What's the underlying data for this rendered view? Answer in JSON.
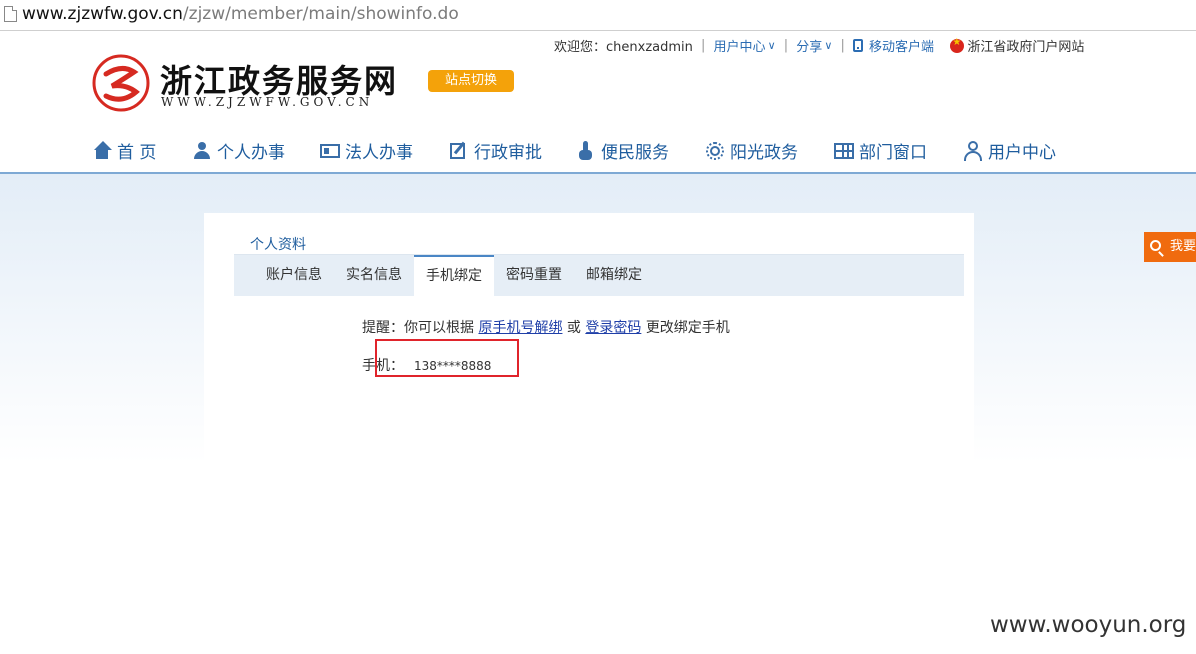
{
  "browser": {
    "url_host": "www.zjzwfw.gov.cn",
    "url_path": "/zjzw/member/main/showinfo.do"
  },
  "utility_bar": {
    "welcome": "欢迎您：chenxzadmin",
    "user_center": "用户中心",
    "share": "分享",
    "mobile_client": "移动客户端",
    "portal": "浙江省政府门户网站"
  },
  "logo": {
    "title": "浙江政务服务网",
    "subtitle": "WWW.ZJZWFW.GOV.CN",
    "site_switch": "站点切换"
  },
  "main_nav": [
    {
      "label": "首 页",
      "icon": "home-icon"
    },
    {
      "label": "个人办事",
      "icon": "person-icon"
    },
    {
      "label": "法人办事",
      "icon": "id-card-icon"
    },
    {
      "label": "行政审批",
      "icon": "edit-icon"
    },
    {
      "label": "便民服务",
      "icon": "hand-icon"
    },
    {
      "label": "阳光政务",
      "icon": "sun-icon"
    },
    {
      "label": "部门窗口",
      "icon": "grid-icon"
    },
    {
      "label": "用户中心",
      "icon": "user-icon"
    }
  ],
  "profile": {
    "title": "个人资料",
    "tabs": [
      "账户信息",
      "实名信息",
      "手机绑定",
      "密码重置",
      "邮箱绑定"
    ],
    "active_tab": "手机绑定",
    "hint_prefix": "提醒：你可以根据",
    "hint_link1": "原手机号解绑",
    "hint_or": "或",
    "hint_link2": "登录密码",
    "hint_suffix": "更改绑定手机",
    "phone_label": "手机：",
    "phone_value": "138****8888"
  },
  "side_float": {
    "label": "我要"
  },
  "watermark": "www.wooyun.org",
  "colors": {
    "brand_blue": "#1f5d9e",
    "switch_orange": "#f4a20a",
    "side_orange": "#f06b0f",
    "highlight_red": "#e0242b"
  }
}
